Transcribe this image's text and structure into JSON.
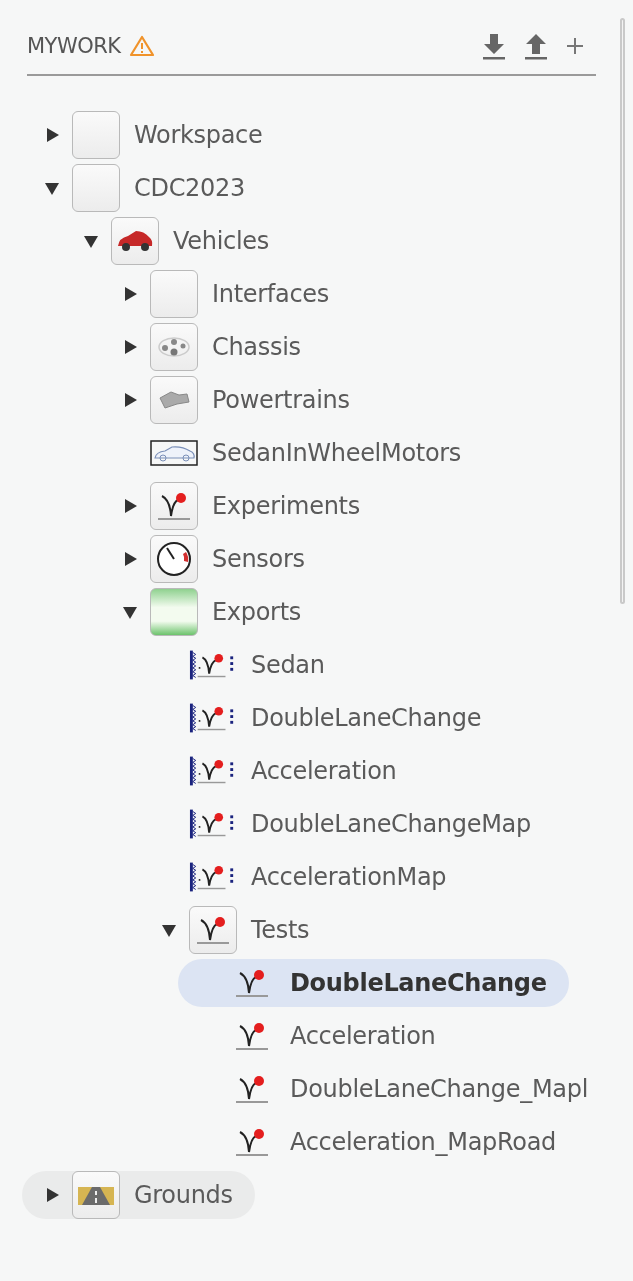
{
  "header": {
    "title": "MYWORK",
    "warning": true
  },
  "tree": [
    {
      "label": "Workspace",
      "kind": "folder",
      "expanded": false,
      "selected": false
    },
    {
      "label": "CDC2023",
      "kind": "folder",
      "expanded": true,
      "selected": false,
      "children": [
        {
          "label": "Vehicles",
          "kind": "car",
          "expanded": true,
          "selected": false,
          "children": [
            {
              "label": "Interfaces",
              "kind": "folder",
              "expanded": false,
              "selected": false
            },
            {
              "label": "Chassis",
              "kind": "chassis",
              "expanded": false,
              "selected": false
            },
            {
              "label": "Powertrains",
              "kind": "powertrain",
              "expanded": false,
              "selected": false
            },
            {
              "label": "SedanInWheelMotors",
              "kind": "model",
              "selected": false
            },
            {
              "label": "Experiments",
              "kind": "experiment",
              "expanded": false,
              "selected": false
            },
            {
              "label": "Sensors",
              "kind": "sensor",
              "expanded": false,
              "selected": false
            },
            {
              "label": "Exports",
              "kind": "exports",
              "expanded": true,
              "selected": false,
              "children": [
                {
                  "label": "Sedan",
                  "kind": "export",
                  "selected": false
                },
                {
                  "label": "DoubleLaneChange",
                  "kind": "export",
                  "selected": false
                },
                {
                  "label": "Acceleration",
                  "kind": "export",
                  "selected": false
                },
                {
                  "label": "DoubleLaneChangeMap",
                  "kind": "export",
                  "selected": false
                },
                {
                  "label": "AccelerationMap",
                  "kind": "export",
                  "selected": false
                },
                {
                  "label": "Tests",
                  "kind": "experiment",
                  "expanded": true,
                  "selected": false,
                  "children": [
                    {
                      "label": "DoubleLaneChange",
                      "kind": "test",
                      "selected": true
                    },
                    {
                      "label": "Acceleration",
                      "kind": "test",
                      "selected": false
                    },
                    {
                      "label": "DoubleLaneChange_Mapl",
                      "kind": "test",
                      "selected": false
                    },
                    {
                      "label": "Acceleration_MapRoad",
                      "kind": "test",
                      "selected": false
                    }
                  ]
                }
              ]
            }
          ]
        }
      ]
    },
    {
      "label": "Grounds",
      "kind": "ground",
      "expanded": false,
      "selected": false,
      "hovered": true
    }
  ]
}
